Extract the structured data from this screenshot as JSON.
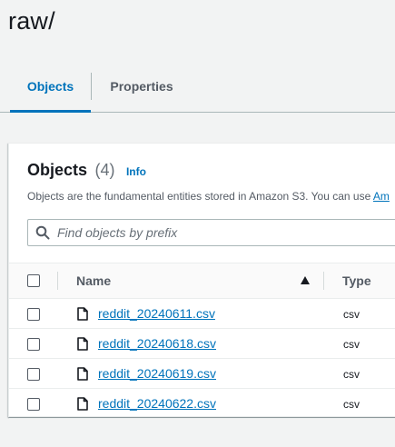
{
  "header": {
    "title": "raw/"
  },
  "tabs": [
    {
      "label": "Objects",
      "active": true
    },
    {
      "label": "Properties",
      "active": false
    }
  ],
  "objects_panel": {
    "title": "Objects",
    "count": "(4)",
    "info_label": "Info",
    "description": "Objects are the fundamental entities stored in Amazon S3. You can use ",
    "description_link": "Am",
    "search": {
      "placeholder": "Find objects by prefix",
      "value": "",
      "icon": "search-icon"
    },
    "columns": {
      "name": "Name",
      "type": "Type",
      "sort": "ascending"
    },
    "rows": [
      {
        "name": "reddit_20240611.csv",
        "type": "csv",
        "icon": "file-icon"
      },
      {
        "name": "reddit_20240618.csv",
        "type": "csv",
        "icon": "file-icon"
      },
      {
        "name": "reddit_20240619.csv",
        "type": "csv",
        "icon": "file-icon"
      },
      {
        "name": "reddit_20240622.csv",
        "type": "csv",
        "icon": "file-icon"
      }
    ]
  },
  "colors": {
    "accent": "#0073bb",
    "text": "#16191f",
    "muted": "#545b64",
    "background": "#f2f3f3"
  }
}
